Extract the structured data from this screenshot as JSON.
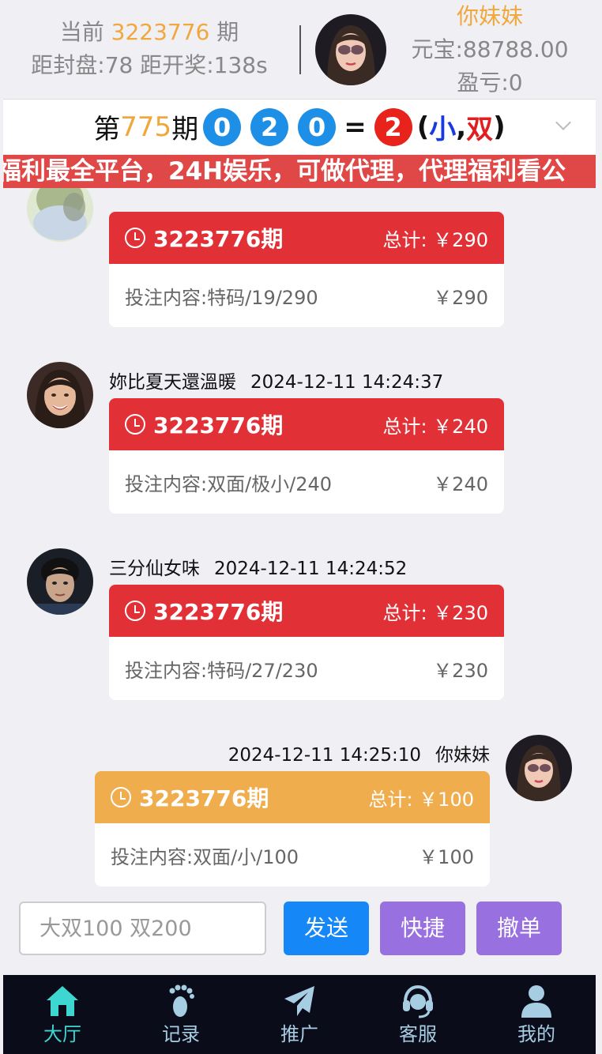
{
  "header": {
    "current_prefix": "当前",
    "current_issue": "3223776",
    "current_suffix": "期",
    "countdown": "距封盘:78 距开奖:138s",
    "username": "你妹妹",
    "balance": "元宝:88788.00",
    "profit": "盈亏:0"
  },
  "result": {
    "prefix": "第",
    "issue": "775",
    "suffix": "期",
    "balls": [
      "0",
      "2",
      "0"
    ],
    "equals": "=",
    "sum": "2",
    "open_paren": "(",
    "small": "小",
    "comma": ",",
    "double": "双",
    "close_paren": ")"
  },
  "marquee": "福利最全平台，24H娱乐，可做代理，代理福利看公",
  "messages": [
    {
      "name": "",
      "time": "",
      "issue": "3223776期",
      "total": "总计:  ￥290",
      "content": "投注内容:特码/19/290",
      "amount": "￥290"
    },
    {
      "name": "妳比夏天還溫暖",
      "time": "2024-12-11 14:24:37",
      "issue": "3223776期",
      "total": "总计:  ￥240",
      "content": "投注内容:双面/极小/240",
      "amount": "￥240"
    },
    {
      "name": "三分仙女味",
      "time": "2024-12-11 14:24:52",
      "issue": "3223776期",
      "total": "总计:  ￥230",
      "content": "投注内容:特码/27/230",
      "amount": "￥230"
    },
    {
      "name": "你妹妹",
      "time": "2024-12-11 14:25:10",
      "issue": "3223776期",
      "total": "总计:  ￥100",
      "content": "投注内容:双面/小/100",
      "amount": "￥100"
    }
  ],
  "input": {
    "placeholder": "大双100 双200"
  },
  "buttons": {
    "send": "发送",
    "quick": "快捷",
    "cancel": "撤单"
  },
  "nav": [
    {
      "label": "大厅",
      "icon": "home-icon"
    },
    {
      "label": "记录",
      "icon": "footprint-icon"
    },
    {
      "label": "推广",
      "icon": "paper-plane-icon"
    },
    {
      "label": "客服",
      "icon": "headset-icon"
    },
    {
      "label": "我的",
      "icon": "user-icon"
    }
  ],
  "colors": {
    "accent_orange": "#f0a83c",
    "card_red": "#e13137",
    "card_mine": "#f0ad4e",
    "ball_blue": "#1e8fe6",
    "ball_red": "#e8231b",
    "send_blue": "#1587f7",
    "purple": "#9870e0",
    "nav_bg": "#0a0c1a",
    "nav_active": "#3ed6d0"
  }
}
